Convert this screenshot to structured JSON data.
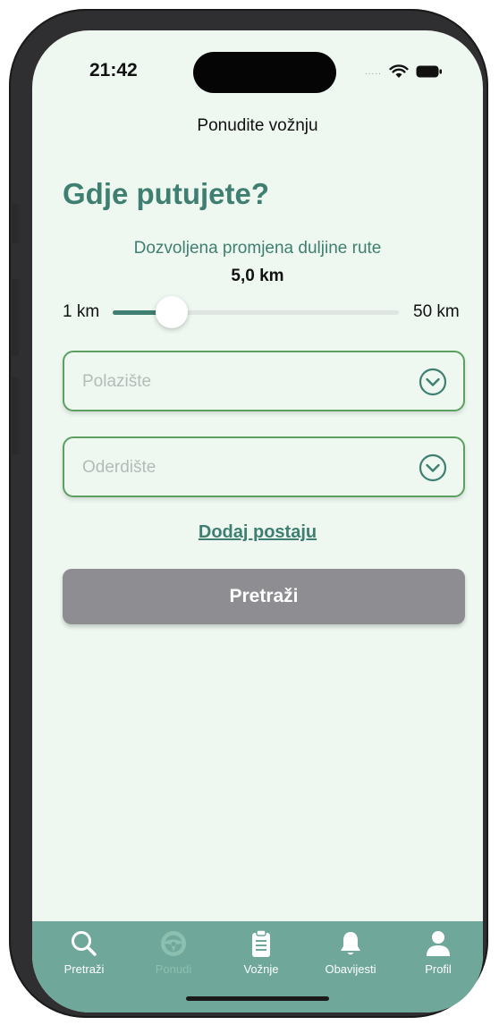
{
  "status_bar": {
    "time": "21:42",
    "carrier_dots": "....."
  },
  "header": {
    "title": "Ponudite vožnju"
  },
  "main": {
    "heading": "Gdje putujete?",
    "route_change": {
      "label": "Dozvoljena promjena duljine rute",
      "value_text": "5,0 km",
      "value": 5.0,
      "min_label": "1 km",
      "max_label": "50 km",
      "min": 1,
      "max": 50
    },
    "departure": {
      "placeholder": "Polazište",
      "icon": "chevron-down-circle-icon"
    },
    "destination": {
      "placeholder": "Oderdište",
      "icon": "chevron-down-circle-icon"
    },
    "add_stop": "Dodaj postaju",
    "search_button": "Pretraži"
  },
  "tabbar": {
    "items": [
      {
        "label": "Pretraži",
        "icon": "search-icon",
        "active": true
      },
      {
        "label": "Ponudi",
        "icon": "steering-wheel-icon",
        "active": false
      },
      {
        "label": "Vožnje",
        "icon": "clipboard-icon",
        "active": true
      },
      {
        "label": "Obavijesti",
        "icon": "bell-icon",
        "active": true
      },
      {
        "label": "Profil",
        "icon": "person-icon",
        "active": true
      }
    ]
  },
  "colors": {
    "accent": "#3f7f71",
    "field_border": "#5aa05e",
    "background": "#eef8f1",
    "tabbar": "#6fa89a",
    "button_disabled": "#8e8e92"
  }
}
